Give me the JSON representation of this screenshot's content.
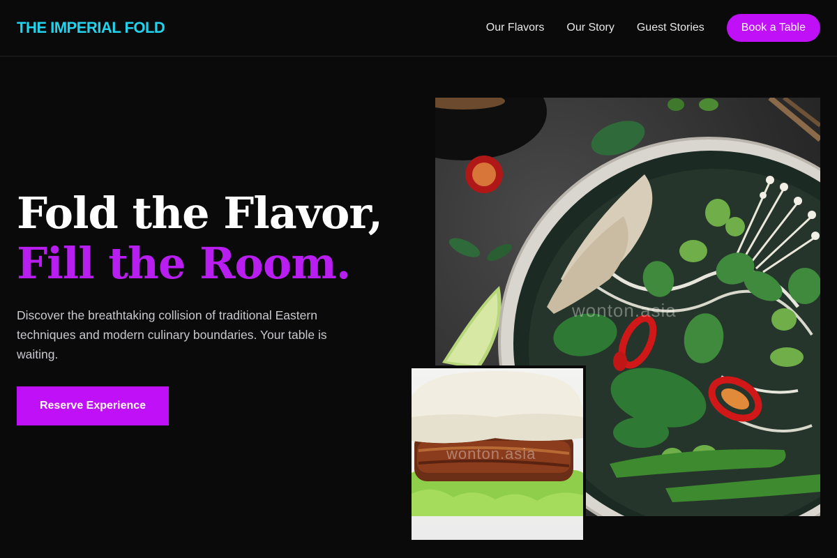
{
  "brand": {
    "name": "THE IMPERIAL FOLD"
  },
  "nav": {
    "links": [
      "Our Flavors",
      "Our Story",
      "Guest Stories"
    ],
    "cta_label": "Book a Table"
  },
  "hero": {
    "heading_line1": "Fold the Flavor,",
    "heading_line2": "Fill the Room.",
    "description": "Discover the breathtaking collision of traditional Eastern techniques and modern culinary boundaries. Your table is waiting.",
    "cta_label": "Reserve Experience"
  },
  "images": {
    "main_watermark": "wonton.asia",
    "inset_watermark": "wonton.asia"
  },
  "colors": {
    "background": "#0a0a0a",
    "logo": "#22d3ee",
    "accent": "#c010f8",
    "heading_accent": "#b81ef0"
  }
}
